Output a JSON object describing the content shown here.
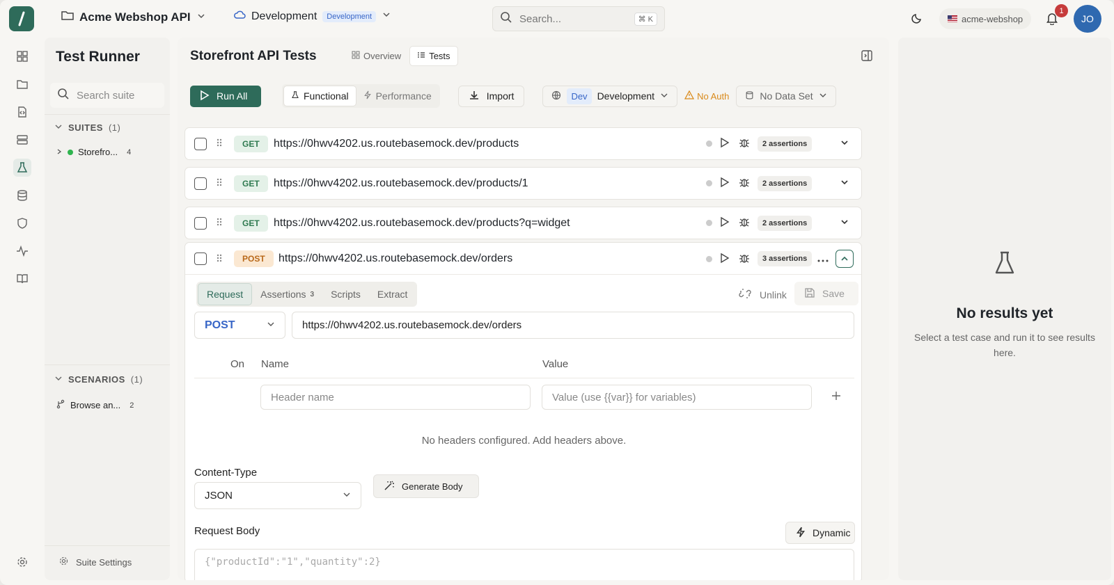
{
  "topbar": {
    "project": "Acme Webshop API",
    "environment": "Development",
    "environment_badge": "Development",
    "search_placeholder": "Search...",
    "search_shortcut": "⌘ K",
    "workspace": "acme-webshop",
    "notifications_count": "1",
    "avatar_initials": "JO"
  },
  "sidebar": {
    "title": "Test Runner",
    "search_placeholder": "Search suite",
    "suites_label": "SUITES",
    "suites_count": "(1)",
    "suite_items": [
      {
        "label": "Storefro...",
        "count": "4"
      }
    ],
    "scenarios_label": "SCENARIOS",
    "scenarios_count": "(1)",
    "scenario_items": [
      {
        "label": "Browse an...",
        "count": "2"
      }
    ],
    "settings_label": "Suite Settings"
  },
  "main": {
    "title": "Storefront API Tests",
    "view_tabs": [
      "Overview",
      "Tests"
    ],
    "run_all": "Run All",
    "mode_tabs": [
      "Functional",
      "Performance"
    ],
    "import": "Import",
    "env_badge": "Dev",
    "env_name": "Development",
    "auth": "No Auth",
    "dataset": "No Data Set",
    "tests": [
      {
        "method": "GET",
        "url": "https://0hwv4202.us.routebasemock.dev/products",
        "assertions": "2 assertions"
      },
      {
        "method": "GET",
        "url": "https://0hwv4202.us.routebasemock.dev/products/1",
        "assertions": "2 assertions"
      },
      {
        "method": "GET",
        "url": "https://0hwv4202.us.routebasemock.dev/products?q=widget",
        "assertions": "2 assertions"
      },
      {
        "method": "POST",
        "url": "https://0hwv4202.us.routebasemock.dev/orders",
        "assertions": "3 assertions"
      }
    ],
    "editor": {
      "tabs": [
        "Request",
        "Assertions",
        "Scripts",
        "Extract"
      ],
      "assertions_count": "3",
      "unlink": "Unlink",
      "save": "Save",
      "method": "POST",
      "url": "https://0hwv4202.us.routebasemock.dev/orders",
      "col_on": "On",
      "col_name": "Name",
      "col_value": "Value",
      "header_name_placeholder": "Header name",
      "header_value_placeholder": "Value (use {{var}} for variables)",
      "no_headers": "No headers configured. Add headers above.",
      "content_type_label": "Content-Type",
      "content_type": "JSON",
      "generate_body": "Generate Body",
      "request_body_label": "Request Body",
      "dynamic": "Dynamic",
      "body": "{\"productId\":\"1\",\"quantity\":2}"
    }
  },
  "results": {
    "title": "No results yet",
    "message": "Select a test case and run it to see results here."
  },
  "colors": {
    "accent": "#2e6b5a",
    "get": "#2f7a50",
    "post": "#b9691a",
    "env": "#3866c7"
  }
}
